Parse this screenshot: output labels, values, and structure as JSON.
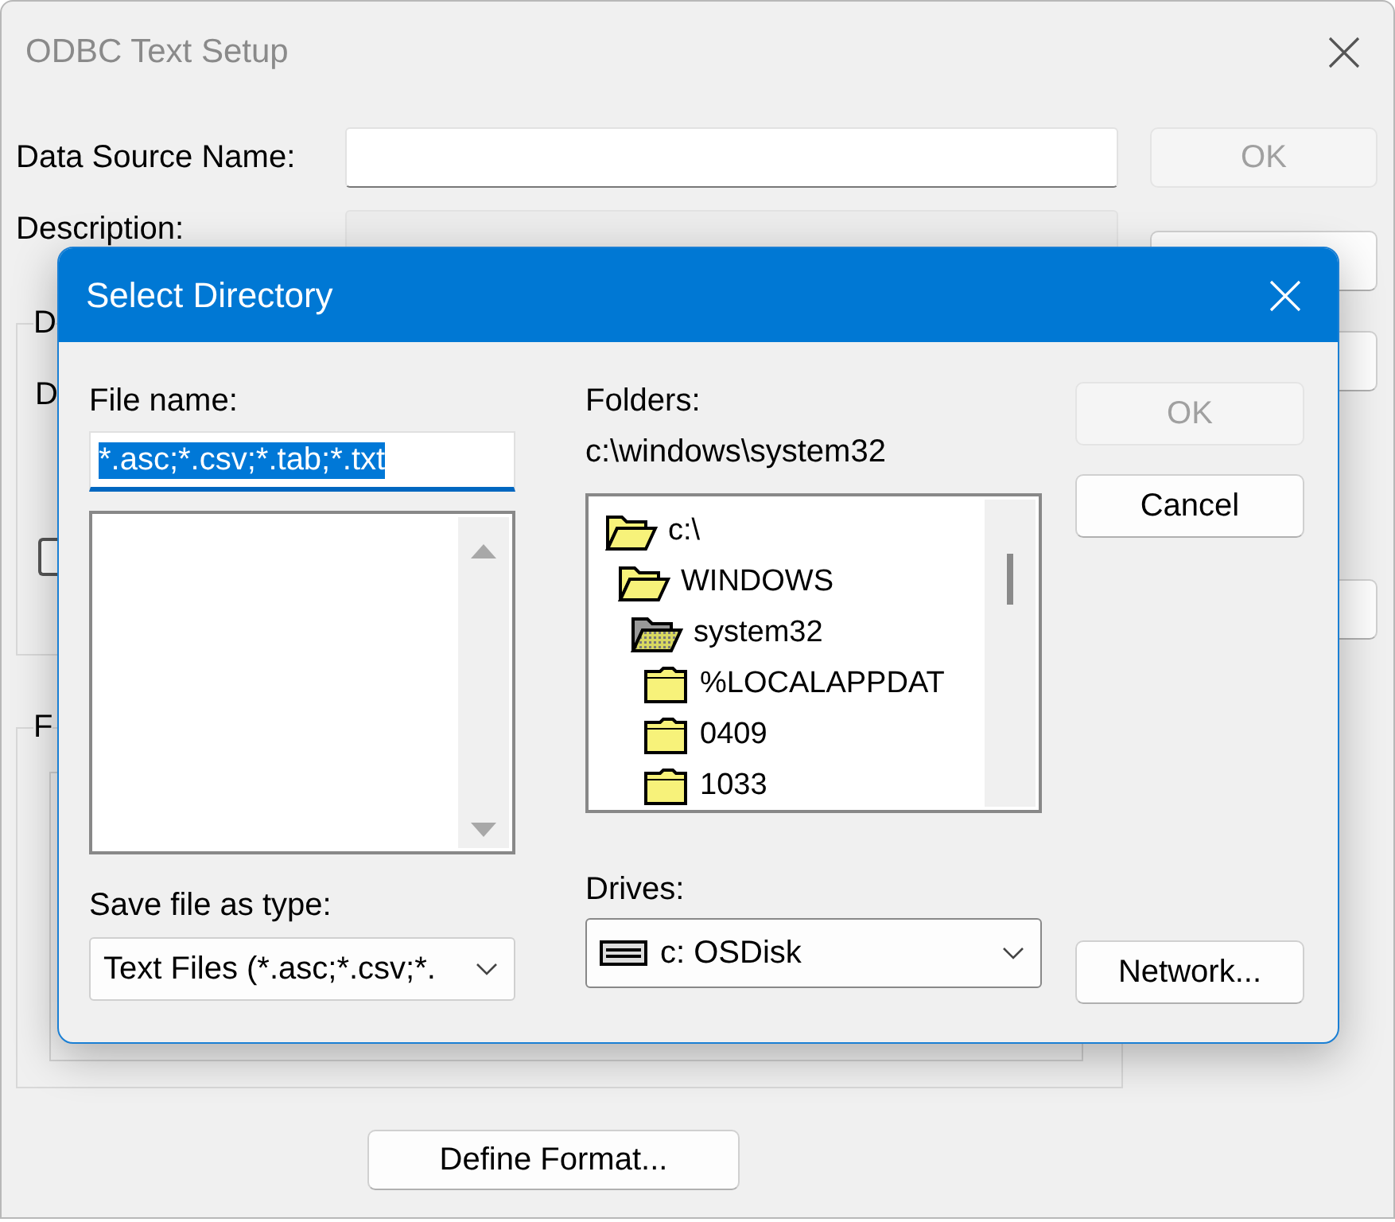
{
  "main_window": {
    "title": "ODBC Text Setup",
    "fields": [
      {
        "label": "Data Source Name:",
        "disabled": false
      },
      {
        "label": "Description:",
        "disabled": true
      }
    ],
    "ok_button": {
      "label": "OK",
      "disabled": true
    },
    "groups": [
      {
        "label": "D",
        "field_label": "D",
        "checkbox": {
          "checked": false
        }
      },
      {
        "label": "F"
      }
    ],
    "define_format_button": {
      "label": "Define Format...",
      "disabled": false
    }
  },
  "dialog": {
    "title": "Select Directory",
    "file_name": {
      "label": "File name:",
      "value": "*.asc;*.csv;*.tab;*.txt",
      "text_selected": true
    },
    "file_type": {
      "label": "Save file as type:",
      "value": "Text Files (*.asc;*.csv;*."
    },
    "folders": {
      "label": "Folders:",
      "path": "c:\\windows\\system32",
      "tree": [
        {
          "label": "c:\\",
          "expanded": true,
          "selected": false,
          "children": [
            {
              "label": "WINDOWS",
              "expanded": true,
              "selected": false,
              "children": [
                {
                  "label": "system32",
                  "expanded": true,
                  "selected": true,
                  "children": [
                    {
                      "label": "%LOCALAPPDAT",
                      "expanded": false,
                      "selected": false
                    },
                    {
                      "label": "0409",
                      "expanded": false,
                      "selected": false
                    },
                    {
                      "label": "1033",
                      "expanded": false,
                      "selected": false
                    }
                  ]
                }
              ]
            }
          ]
        }
      ]
    },
    "drives": {
      "label": "Drives:",
      "value": "c: OSDisk"
    },
    "buttons": [
      {
        "label": "OK",
        "disabled": true
      },
      {
        "label": "Cancel",
        "disabled": false
      }
    ],
    "network_button": {
      "label": "Network...",
      "disabled": false
    }
  }
}
